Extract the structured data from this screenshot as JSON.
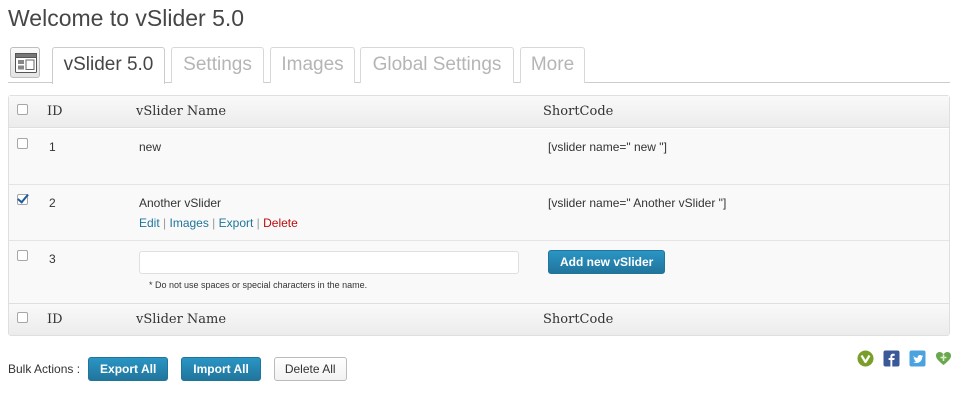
{
  "page": {
    "title": "Welcome to vSlider 5.0"
  },
  "tabs": [
    {
      "label": "vSlider 5.0",
      "active": true
    },
    {
      "label": "Settings",
      "active": false
    },
    {
      "label": "Images",
      "active": false
    },
    {
      "label": "Global Settings",
      "active": false
    },
    {
      "label": "More",
      "active": false
    }
  ],
  "table": {
    "columns": {
      "id": "ID",
      "name": "vSlider Name",
      "shortcode": "ShortCode"
    },
    "rows": [
      {
        "id": "1",
        "name": "new",
        "shortcode": "[vslider name=\" new \"]",
        "checked": false
      },
      {
        "id": "2",
        "name": "Another vSlider",
        "shortcode": "[vslider name=\" Another vSlider \"]",
        "checked": true,
        "actions": {
          "edit": "Edit",
          "images": "Images",
          "export": "Export",
          "delete": "Delete",
          "separator": " | "
        }
      }
    ],
    "new_row": {
      "id": "3",
      "input_value": "",
      "hint": "* Do not use spaces or special characters in the name.",
      "add_button": "Add new vSlider",
      "checked": false
    }
  },
  "bulk": {
    "label": "Bulk Actions :",
    "export_all": "Export All",
    "import_all": "Import All",
    "delete_all": "Delete All"
  },
  "social_icons": [
    "vslider-icon",
    "facebook-icon",
    "twitter-icon",
    "heart-icon"
  ],
  "colors": {
    "accent": "#21759b",
    "delete": "#bc0b0b",
    "twitter": "#4aa3df",
    "facebook": "#3b5998",
    "green": "#6aa84f"
  }
}
